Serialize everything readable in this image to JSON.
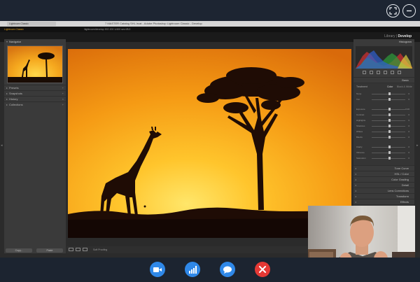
{
  "call": {
    "top_icons": [
      "fullscreen-icon",
      "minimize-icon"
    ],
    "controls": [
      {
        "name": "camera-button",
        "icon": "video-camera-icon",
        "color": "#2f88e8"
      },
      {
        "name": "stats-button",
        "icon": "signal-bars-icon",
        "color": "#2f88e8"
      },
      {
        "name": "chat-button",
        "icon": "chat-bubble-icon",
        "color": "#2f88e8"
      },
      {
        "name": "end-call-button",
        "icon": "close-x-icon",
        "color": "#e53935"
      }
    ]
  },
  "mac": {
    "tab_label": "Lightroom Classic",
    "window_title": "7 MASTER Catalog SHL.lrcat - Adobe Photoshop Lightroom Classic - Develop"
  },
  "lightroom": {
    "info_left": "Lightroom Classic",
    "info_right": "/lightroom/develop   ISO 200   1/400 sec   f/8.0",
    "modules": {
      "library": "Library",
      "sep": "|",
      "develop": "Develop"
    },
    "left_panel": {
      "navigator": "Navigator",
      "sections": [
        "Presets",
        "Snapshots",
        "History",
        "Collections"
      ],
      "buttons": [
        "Copy...",
        "Paste"
      ]
    },
    "right_panel": {
      "histogram": "Histogram",
      "basic": "Basic",
      "treatment": "Treatment",
      "color_label": "Color",
      "bw_label": "Black & White",
      "sliders": [
        {
          "label": "Temp",
          "value": "0"
        },
        {
          "label": "Tint",
          "value": "0"
        },
        {
          "label": "Exposure",
          "value": "0.00"
        },
        {
          "label": "Contrast",
          "value": "0"
        },
        {
          "label": "Highlights",
          "value": "0"
        },
        {
          "label": "Shadows",
          "value": "0"
        },
        {
          "label": "Whites",
          "value": "0"
        },
        {
          "label": "Blacks",
          "value": "0"
        },
        {
          "label": "Clarity",
          "value": "0"
        },
        {
          "label": "Vibrance",
          "value": "0"
        },
        {
          "label": "Saturation",
          "value": "0"
        }
      ],
      "sections": [
        "Tone Curve",
        "HSL / Color",
        "Color Grading",
        "Detail",
        "Lens Corrections",
        "Transform",
        "Effects",
        "Calibration"
      ]
    },
    "toolbar_label": "Soft Proofing"
  }
}
